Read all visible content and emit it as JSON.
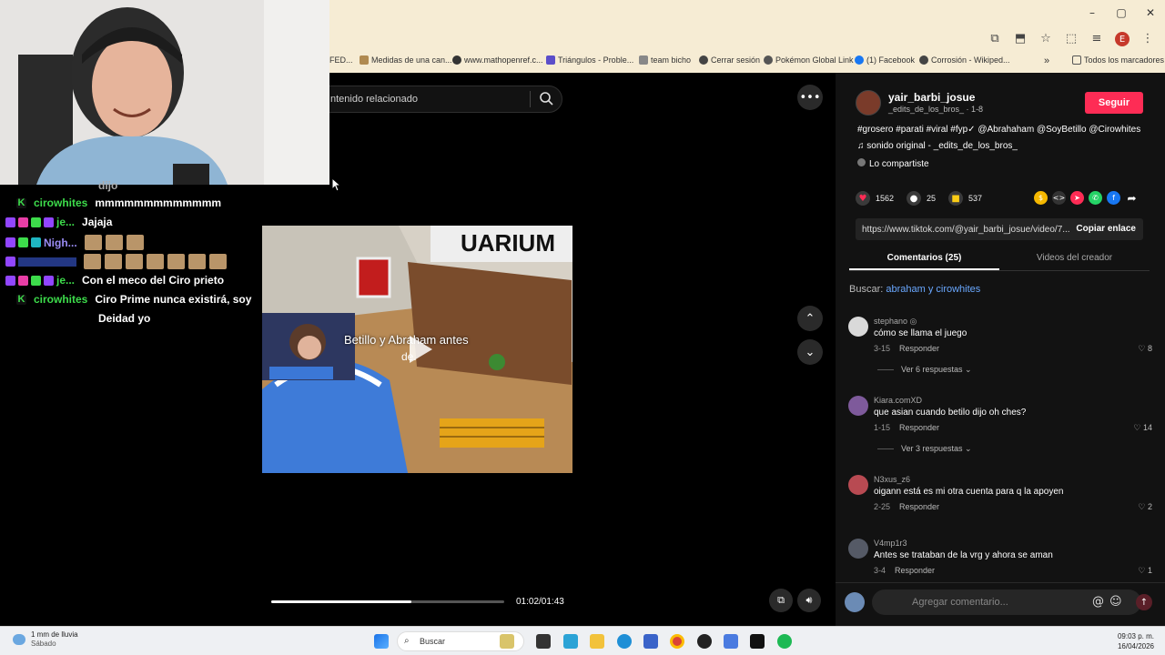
{
  "browser": {
    "window_controls": [
      "–",
      "▢",
      "✕"
    ],
    "profile_initial": "E",
    "bookmarks": [
      {
        "label": "FED...",
        "color": "#e6b63c"
      },
      {
        "label": "Medidas de una can...",
        "color": "#b08a50"
      },
      {
        "label": "www.mathopenref.c...",
        "color": "#333333"
      },
      {
        "label": "Triángulos - Proble...",
        "color": "#5b4ec9"
      },
      {
        "label": "team bicho",
        "color": "#666666"
      },
      {
        "label": "Cerrar sesión",
        "color": "#444444"
      },
      {
        "label": "Pokémon Global Link",
        "color": "#555555"
      },
      {
        "label": "(1) Facebook",
        "color": "#1877f2"
      },
      {
        "label": "Corrosión - Wikiped...",
        "color": "#444444"
      }
    ],
    "bookmarks_more": "»",
    "all_bookmarks": "Todos los marcadores"
  },
  "tiktok": {
    "search_placeholder": "ntenido relacionado",
    "video_caption": "Betillo y Abraham antes",
    "video_caption_line2": "de.",
    "time": "01:02/01:43",
    "progress_fraction": 0.6,
    "author": {
      "name": "yair_barbi_josue",
      "sub": "_edits_de_los_bros_ · 1-8",
      "follow_label": "Seguir"
    },
    "description": "#grosero #parati #viral #fyp✓ @Abrahaham @SoyBetillo @Cirowhites",
    "sound": "♫  sonido original - _edits_de_los_bros_",
    "shared": "Lo compartiste",
    "likes": "1562",
    "comments_count": "25",
    "saves": "537",
    "link": "https://www.tiktok.com/@yair_barbi_josue/video/7...",
    "copy_link": "Copiar enlace",
    "tabs": {
      "comments": "Comentarios (25)",
      "videos": "Videos del creador"
    },
    "search_hint": {
      "prefix": "Buscar:",
      "keyword": "abraham y cirowhites"
    },
    "comment_list": [
      {
        "user": "stephano ◎",
        "text": "cómo se llama el juego",
        "date": "3-15",
        "reply": "Responder",
        "likes": "8",
        "more": "Ver 6 respuestas",
        "avatar": "#d9d9d9"
      },
      {
        "user": "Kiara.comXD",
        "text": "que asian cuando betilo dijo oh ches?",
        "date": "1-15",
        "reply": "Responder",
        "likes": "14",
        "more": "Ver 3 respuestas",
        "avatar": "#7e5a9b"
      },
      {
        "user": "N3xus_z6",
        "text": "oigann está es mi otra cuenta para q la apoyen",
        "date": "2-25",
        "reply": "Responder",
        "likes": "2",
        "more": "",
        "avatar": "#b84a52"
      },
      {
        "user": "V4mp1r3",
        "text": "Antes se trataban de la vrg y ahora se aman",
        "date": "3-4",
        "reply": "Responder",
        "likes": "1",
        "more": "",
        "avatar": "#555a66"
      }
    ],
    "comment_placeholder": "Agregar comentario..."
  },
  "chat": [
    {
      "name": "cirowhites",
      "name_color": "#3ddc4b",
      "msg": "mmmmmmmmmmmmm",
      "emotes": 0
    },
    {
      "name": "je...",
      "name_color": "#3ddc4b",
      "msg": "Jajaja",
      "emotes": 0
    },
    {
      "name": "Nigh...",
      "name_color": "#9a8cf5",
      "msg": "",
      "emotes": 3
    },
    {
      "name": "",
      "name_color": "#3b5bdb",
      "msg": "",
      "emotes": 7
    },
    {
      "name": "je...",
      "name_color": "#3ddc4b",
      "msg": "Con el meco del Ciro prieto",
      "emotes": 0
    },
    {
      "name": "cirowhites",
      "name_color": "#3ddc4b",
      "msg": "Ciro Prime nunca existirá, soy",
      "emotes": 0
    }
  ],
  "chat_continuation": "Deidad yo",
  "chat_top_fragment": "dijo",
  "taskbar": {
    "weather_line1": "1 mm de lluvia",
    "weather_line2": "Sábado",
    "search": "Buscar",
    "time": "09:03 p. m.",
    "date": "16/04/2026"
  }
}
